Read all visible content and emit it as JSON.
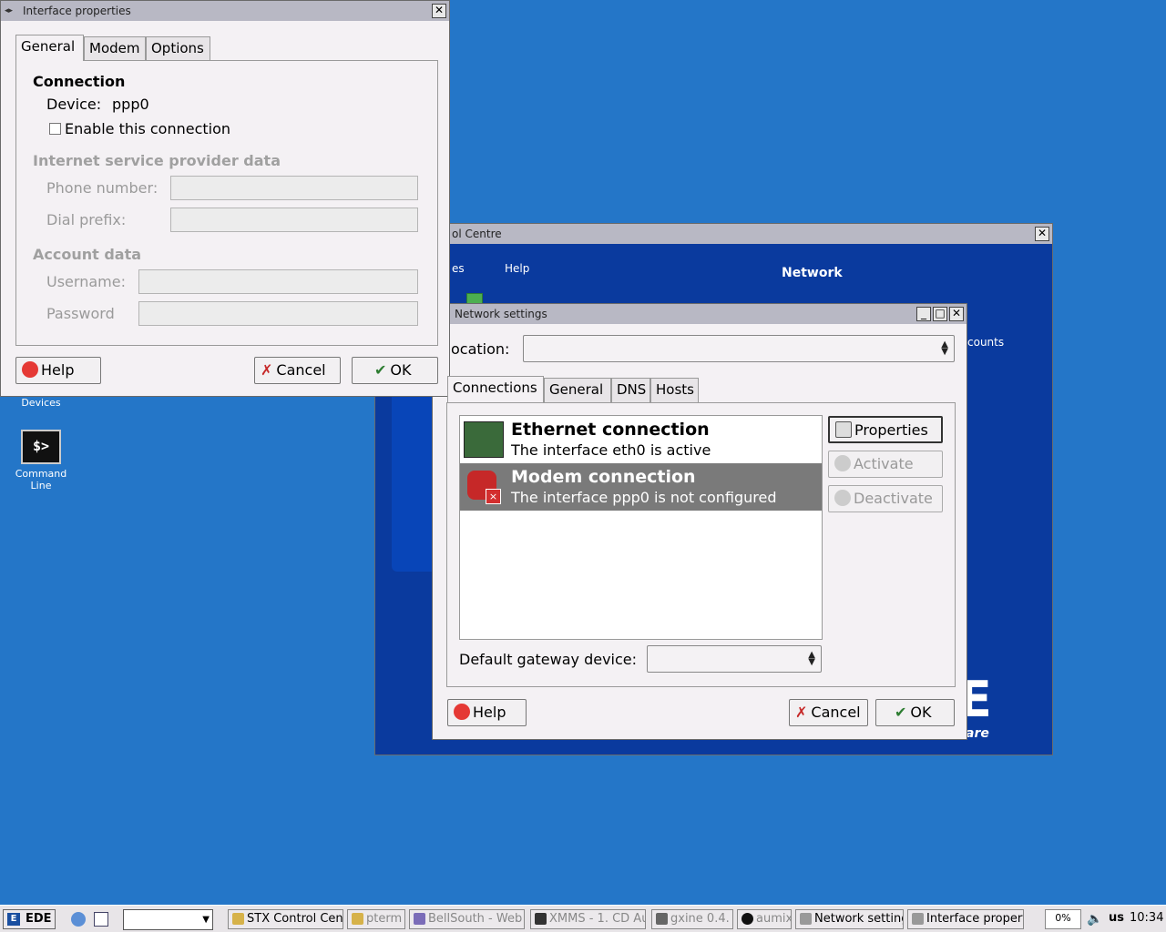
{
  "desktop": {
    "devices_label": "Devices",
    "command_line_label": "Command Line",
    "terminal_glyph": "$>"
  },
  "control_centre": {
    "title": "ol Centre",
    "menu_partial": "es",
    "menu_help": "Help",
    "section": "Network",
    "side_text": "counts",
    "brand_letter": "E",
    "brand_text": "are"
  },
  "interface_properties": {
    "title": "Interface properties",
    "tabs": [
      "General",
      "Modem",
      "Options"
    ],
    "connection_heading": "Connection",
    "device_label": "Device:",
    "device_value": "ppp0",
    "enable_label": "Enable this connection",
    "isp_heading": "Internet service provider data",
    "phone_label": "Phone number:",
    "dial_label": "Dial prefix:",
    "account_heading": "Account data",
    "username_label": "Username:",
    "password_label": "Password",
    "help": "Help",
    "cancel": "Cancel",
    "ok": "OK"
  },
  "network_settings": {
    "title": "Network settings",
    "location_label": "ocation:",
    "tabs": [
      "Connections",
      "General",
      "DNS",
      "Hosts"
    ],
    "connections": [
      {
        "name": "Ethernet connection",
        "status": "The interface eth0 is active"
      },
      {
        "name": "Modem connection",
        "status": "The interface ppp0 is not configured"
      }
    ],
    "properties": "Properties",
    "activate": "Activate",
    "deactivate": "Deactivate",
    "gateway_label": "Default gateway device:",
    "help": "Help",
    "cancel": "Cancel",
    "ok": "OK"
  },
  "taskbar": {
    "start": "EDE",
    "tasks": [
      "STX Control Cent",
      "pterm",
      "BellSouth - Web",
      "XMMS - 1. CD Au",
      "gxine 0.4.",
      "aumix",
      "Network setting",
      "Interface propert"
    ],
    "cpu": "0%",
    "layout": "us",
    "clock": "10:34"
  },
  "colors": {
    "desktop": "#2476c8",
    "control_centre_bg": "#0a3a9e",
    "selection": "#7a7a7a"
  }
}
